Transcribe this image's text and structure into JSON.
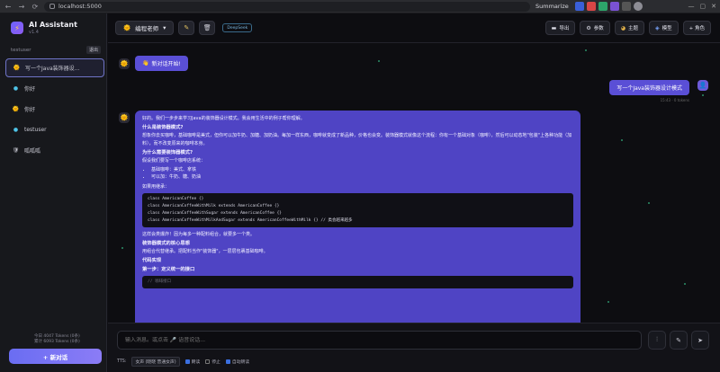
{
  "browser": {
    "url": "localhost:5000",
    "summarize_label": "Summarize"
  },
  "sidebar": {
    "app_title": "AI Assistant",
    "app_version": "v1.4",
    "username": "testuser",
    "logout_label": "退出",
    "conversations": [
      {
        "label": "写一个Java装饰器设...",
        "icon": "🌞",
        "active": true
      },
      {
        "label": "你好",
        "icon": "●",
        "active": false
      },
      {
        "label": "你好",
        "icon": "🌞",
        "active": false
      },
      {
        "label": "testuser",
        "icon": "●",
        "active": false
      },
      {
        "label": "呱呱呱",
        "icon": "🛡",
        "active": false
      }
    ],
    "token_line_1": "今日 4047 Tokens (0条)",
    "token_line_2": "累计 6093 Tokens (0条)",
    "new_chat_label": "+ 新对话"
  },
  "topbar": {
    "persona_label": "编程老师",
    "model_badge": "DeepSeek",
    "actions": {
      "export": "导出",
      "params": "参数",
      "theme": "主题",
      "model": "模型",
      "role": "+ 角色"
    }
  },
  "chat": {
    "start_message": "新对话开始!",
    "user_message": "写一个Java装饰器设计模式",
    "user_meta": "15:43 · 0 tokens",
    "ai": {
      "p1": "好的。我们一步步来学习Java的装饰器设计模式。我会用生活中的例子帮你理解。",
      "h1": "什么是装饰器模式?",
      "p2": "想象你去买咖啡，基础咖啡是美式，但你可以加牛奶、加糖、加奶油。每加一样东西，咖啡就变成了新品种，价格也会变。装饰器模式就像这个流程：你有一个基础对象（咖啡），然后可以动态地\"包装\"上各种功能（加料），而不改变原来的咖啡本身。",
      "h2": "为什么需要装饰器模式?",
      "p3": "假设我们要写一个咖啡店系统：",
      "li1": "基础咖啡：美式、拿铁",
      "li2": "可以加：牛奶、糖、奶油",
      "p4": "如果用继承：",
      "code": [
        "class AmericanCoffee {}",
        "class AmericanCoffeeWithMilk extends AmericanCoffee {}",
        "class AmericanCoffeeWithSugar extends AmericanCoffee {}",
        "class AmericanCoffeeWithMilkAndSugar extends AmericanCoffeeWithMilk {} // 类会越来越多"
      ],
      "p5": "这样会类爆炸！因为每多一种配料组合，就要多一个类。",
      "h3": "装饰器模式的核心思想",
      "p6": "用组合代替继承。把配料当作\"装饰器\"，一层层包裹基础咖啡。",
      "h4": "代码实现",
      "h5": "第一步：定义统一的接口",
      "code2": "// 咖啡接口"
    }
  },
  "input": {
    "placeholder": "输入消息。或点击 🎤 语音说话...",
    "tts_label": "TTS:",
    "voice_option": "女声 (晓晓 普通女声)",
    "opt_read": "朗读",
    "opt_auto_send": "停止",
    "opt_auto_scroll": "自动朗读"
  }
}
